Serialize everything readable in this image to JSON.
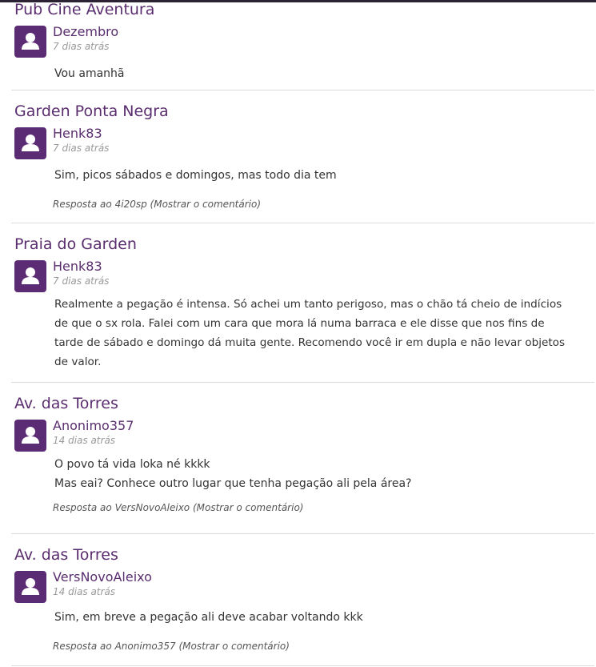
{
  "comments": [
    {
      "place": "Pub Cine Aventura",
      "user": "Dezembro",
      "time": "7 dias atrás",
      "lines": [
        "Vou amanhã"
      ],
      "reply": null
    },
    {
      "place": "Garden Ponta Negra",
      "user": "Henk83",
      "time": "7 dias atrás",
      "lines": [
        "Sim, picos sábados e domingos, mas todo dia tem"
      ],
      "reply": {
        "prefix": "Resposta ao",
        "user": "4i20sp",
        "show": "(Mostrar o comentário)"
      }
    },
    {
      "place": "Praia do Garden",
      "user": "Henk83",
      "time": "7 dias atrás",
      "lines": [
        "Realmente a pegação é intensa. Só achei um tanto perigoso, mas o chão tá cheio de indícios",
        "de que o sx rola. Falei com um cara que mora lá numa barraca e ele disse que nos fins de",
        "tarde de sábado e domingo dá muita gente. Recomendo você ir em dupla e não levar objetos",
        "de valor."
      ],
      "reply": null
    },
    {
      "place": "Av. das Torres",
      "user": "Anonimo357",
      "time": "14 dias atrás",
      "lines": [
        "O povo tá vida loka né kkkk",
        "Mas eai? Conhece outro lugar que tenha pegação ali pela área?"
      ],
      "reply": {
        "prefix": "Resposta ao",
        "user": "VersNovoAleixo",
        "show": "(Mostrar o comentário)"
      }
    },
    {
      "place": "Av. das Torres",
      "user": "VersNovoAleixo",
      "time": "14 dias atrás",
      "lines": [
        "Sim, em breve a pegação ali deve acabar voltando kkk"
      ],
      "reply": {
        "prefix": "Resposta ao",
        "user": "Anonimo357",
        "show": "(Mostrar o comentário)"
      }
    }
  ],
  "avatar_icon": "user-silhouette-icon",
  "colors": {
    "accent": "#5a2d6e",
    "avatar_bg": "#5b2b73",
    "muted": "#9a9a9a",
    "divider": "#dcdcdc"
  }
}
